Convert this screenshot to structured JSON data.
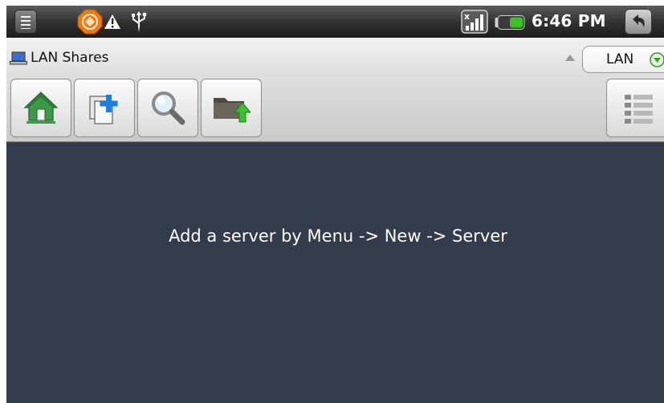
{
  "status_bar": {
    "time": "6:46 PM",
    "icons": [
      "menu-icon",
      "hazard-icon",
      "warning-icon",
      "usb-icon",
      "signal-icon",
      "battery-icon",
      "back-icon"
    ],
    "battery_color": "#3fbf2a"
  },
  "title_bar": {
    "title": "LAN Shares",
    "location_dropdown": "LAN"
  },
  "toolbar": {
    "buttons": [
      "home-icon",
      "new-copy-icon",
      "search-icon",
      "folder-up-icon",
      "list-view-icon"
    ]
  },
  "content": {
    "message": "Add a server by Menu -> New -> Server",
    "background": "#333b4c"
  }
}
